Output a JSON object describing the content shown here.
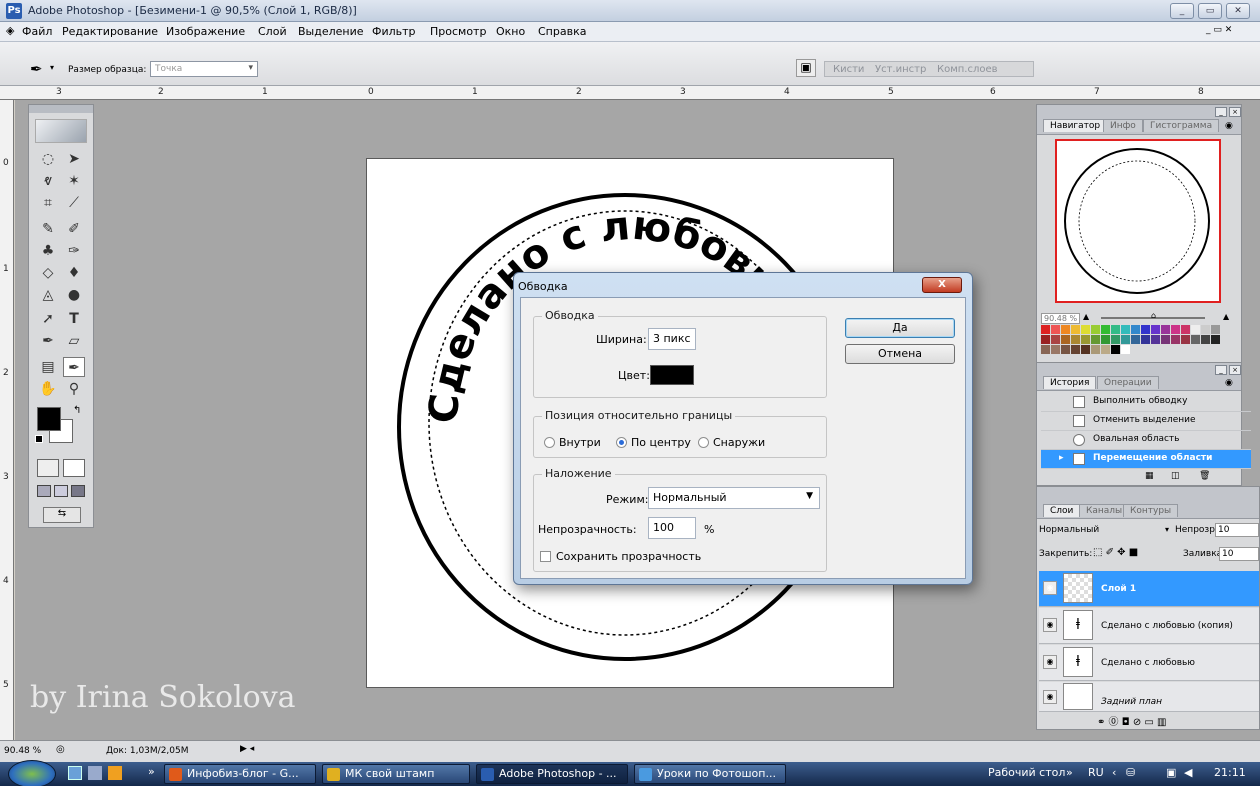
{
  "window": {
    "title": "Adobe Photoshop - [Безимени-1 @ 90,5% (Слой 1, RGB/8)]",
    "logo": "Ps"
  },
  "menu": [
    "Файл",
    "Редактирование",
    "Изображение",
    "Слой",
    "Выделение",
    "Фильтр",
    "Просмотр",
    "Окно",
    "Справка"
  ],
  "options": {
    "sample_size_label": "Размер образца:",
    "sample_size_value": "Точка",
    "wells": [
      "Кисти",
      "Уст.инстр",
      "Комп.слоев"
    ]
  },
  "ruler": {
    "top": [
      "3",
      "2",
      "1",
      "0",
      "1",
      "2",
      "3",
      "4",
      "5",
      "6",
      "7",
      "8"
    ],
    "left": [
      "0",
      "1",
      "2",
      "3",
      "4",
      "5"
    ]
  },
  "canvas": {
    "circle_text": "Сделано с любовью"
  },
  "watermark": "by Irina Sokolova",
  "navigator": {
    "tabs": [
      "Навигатор",
      "Инфо",
      "Гистограмма"
    ],
    "zoom": "90.48 %"
  },
  "history": {
    "tabs": [
      "История",
      "Операции"
    ],
    "items": [
      "Выполнить обводку",
      "Отменить выделение",
      "Овальная область",
      "Перемещение области"
    ],
    "active_index": 3
  },
  "layers": {
    "tabs": [
      "Слои",
      "Каналы",
      "Контуры"
    ],
    "blend_mode": "Нормальный",
    "opacity_label": "Непрозр.:",
    "opacity_value": "10",
    "lock_label": "Закрепить:",
    "fill_label": "Заливка:",
    "fill_value": "10",
    "items": [
      "Слой 1",
      "Сделано с любовью (копия)",
      "Сделано с любовью",
      "Задний план"
    ],
    "active_index": 0
  },
  "dialog": {
    "title": "Обводка",
    "close": "X",
    "stroke_group": "Обводка",
    "width_label": "Ширина:",
    "width_value": "3 пикс",
    "color_label": "Цвет:",
    "color_value": "#000000",
    "position_group": "Позиция относительно границы",
    "position_options": [
      "Внутри",
      "По центру",
      "Снаружи"
    ],
    "position_selected": 1,
    "blend_group": "Наложение",
    "mode_label": "Режим:",
    "mode_value": "Нормальный",
    "opacity_label": "Непрозрачность:",
    "opacity_value": "100",
    "opacity_unit": "%",
    "preserve_label": "Сохранить прозрачность",
    "preserve_checked": false,
    "ok": "Да",
    "cancel": "Отмена"
  },
  "status": {
    "zoom": "90.48 %",
    "doc": "Док: 1,03М/2,05М"
  },
  "taskbar": {
    "buttons": [
      "Инфобиз-блог - G...",
      "МК свой штамп",
      "Adobe Photoshop - ...",
      "Уроки по Фотошоп..."
    ],
    "active_index": 2,
    "tray_desktop": "Рабочий стол",
    "lang": "RU",
    "clock": "21:11"
  },
  "colors": {
    "accent": "#3399ff",
    "fg_color": "#000000",
    "bg_color": "#ffffff",
    "nav_frame": "#e02020"
  }
}
